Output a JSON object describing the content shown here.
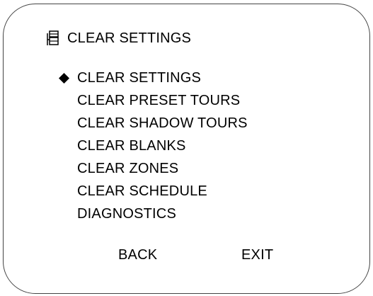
{
  "header": {
    "icon": "menu-tree-icon",
    "title": "CLEAR SETTINGS"
  },
  "menu": {
    "selected_index": 0,
    "cursor_icon": "diamond-cursor-icon",
    "items": [
      {
        "label": "CLEAR SETTINGS"
      },
      {
        "label": "CLEAR PRESET TOURS"
      },
      {
        "label": "CLEAR SHADOW TOURS"
      },
      {
        "label": "CLEAR BLANKS"
      },
      {
        "label": "CLEAR ZONES"
      },
      {
        "label": "CLEAR SCHEDULE"
      },
      {
        "label": "DIAGNOSTICS"
      }
    ]
  },
  "footer": {
    "back_label": "BACK",
    "exit_label": "EXIT"
  }
}
